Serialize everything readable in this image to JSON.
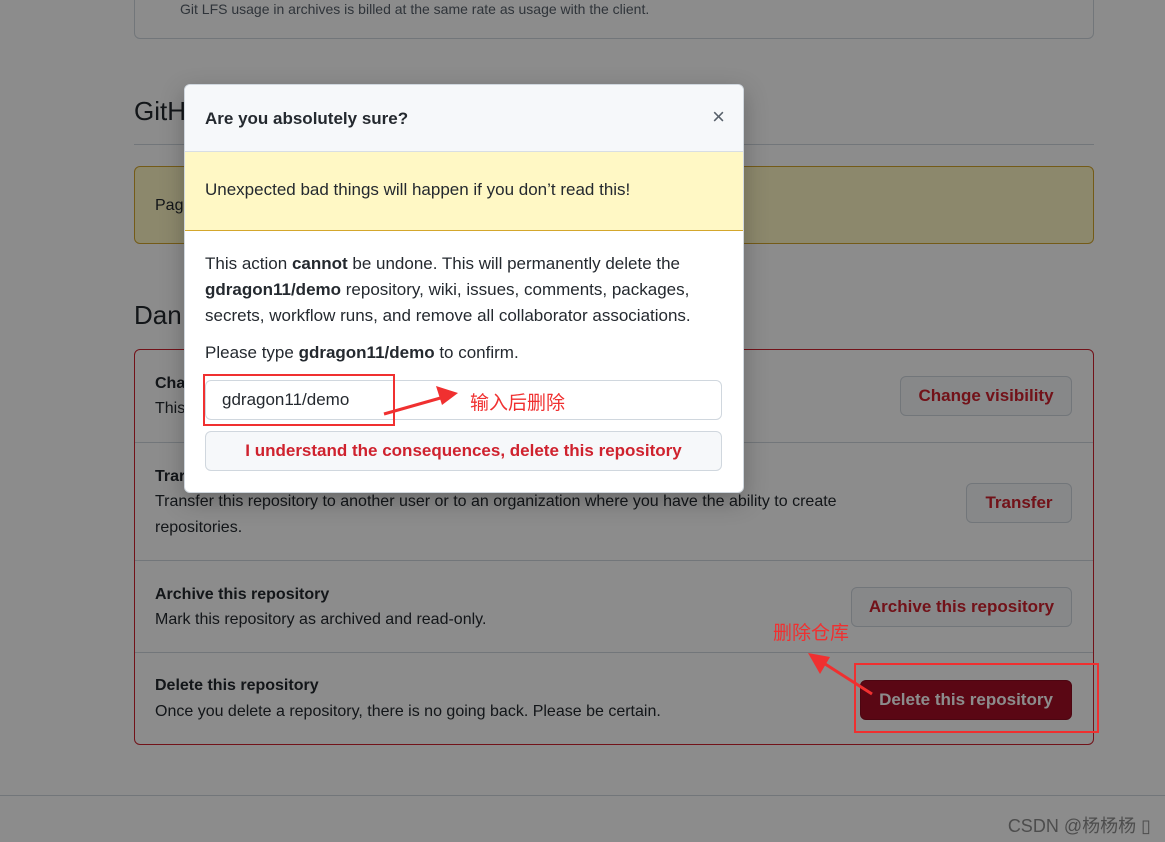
{
  "background": {
    "lfs_note": "Git LFS usage in archives is billed at the same rate as usage with the client.",
    "pages_heading_partial": "GitH",
    "pages_flash_partial": "Pag",
    "danger_heading_partial": "Dan",
    "rows": [
      {
        "title_partial": "Cha",
        "desc_partial": "This",
        "button": "Change visibility"
      },
      {
        "title_partial": "Trar",
        "desc": "Transfer this repository to another user or to an organization where you have the ability to create repositories.",
        "button": "Transfer"
      },
      {
        "title": "Archive this repository",
        "desc": "Mark this repository as archived and read-only.",
        "button": "Archive this repository"
      },
      {
        "title": "Delete this repository",
        "desc": "Once you delete a repository, there is no going back. Please be certain.",
        "button": "Delete this repository"
      }
    ]
  },
  "modal": {
    "title": "Are you absolutely sure?",
    "close_glyph": "×",
    "warning": "Unexpected bad things will happen if you don’t read this!",
    "body_1": "This action ",
    "body_cannot": "cannot",
    "body_2": " be undone. This will permanently delete the ",
    "body_repo": "gdragon11/demo",
    "body_3": " repository, wiki, issues, comments, packages, secrets, workflow runs, and remove all collaborator associations.",
    "confirm_prefix": "Please type ",
    "confirm_repo": "gdragon11/demo",
    "confirm_suffix": " to confirm.",
    "input_value": "gdragon11/demo",
    "confirm_button": "I understand the consequences, delete this repository"
  },
  "annotations": {
    "input_note": "输入后删除",
    "delete_note": "删除仓库",
    "color": "#f03030"
  },
  "watermark": "CSDN @杨杨杨 ▯",
  "colors": {
    "danger_red": "#cf222e",
    "delete_solid": "#a40e26",
    "warning_bg": "#fff8c5"
  }
}
